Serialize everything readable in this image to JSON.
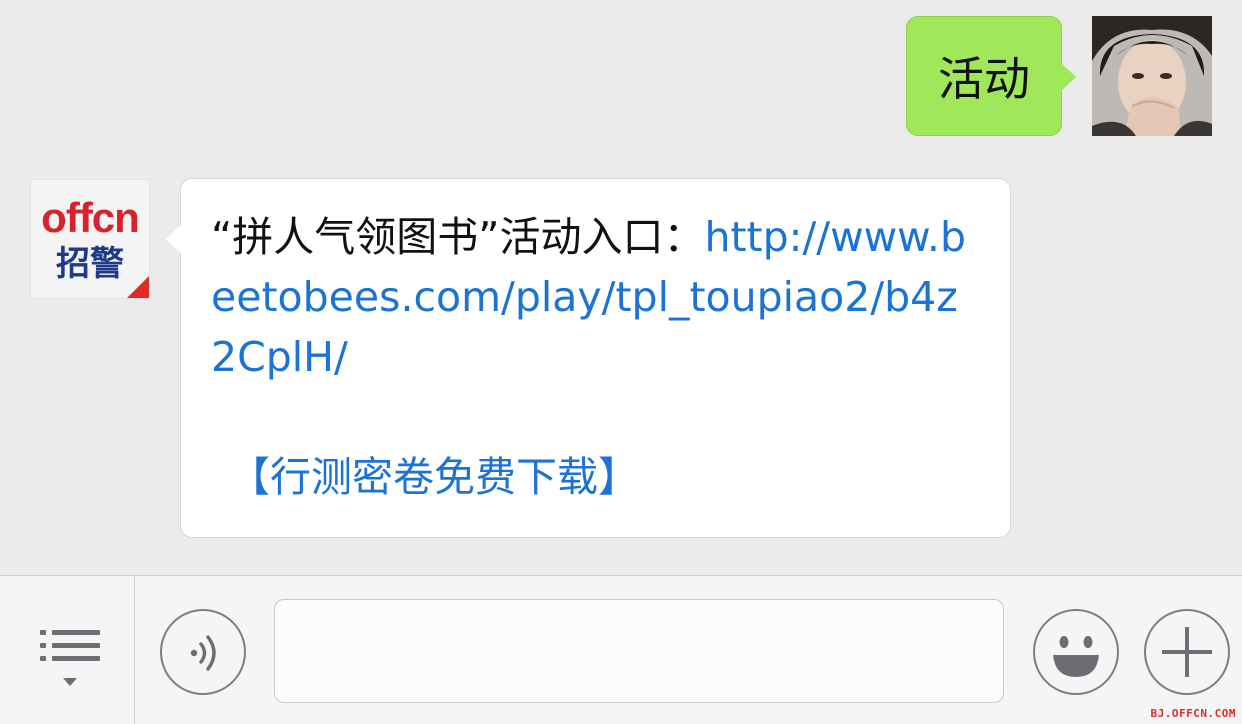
{
  "outgoing_message": {
    "text": "活动",
    "bubble_color": "#a0e75a"
  },
  "incoming_message": {
    "text_prefix": "“拼人气领图书”活动入口：",
    "link_url": "http://www.beetobees.com/play/tpl_toupiao2/b4z2CplH/",
    "download_link": "【行测密卷免费下载】",
    "link_color": "#1b73d6"
  },
  "sender_avatar": {
    "brand": "offcn",
    "subtitle": "招警",
    "brand_color": "#d9232c"
  },
  "input_bar": {
    "menu_icon": "list-menu-icon",
    "voice_icon": "voice-icon",
    "emoji_icon": "smiley-icon",
    "plus_icon": "plus-icon",
    "input_value": ""
  },
  "watermark": "BJ.OFFCN.COM"
}
